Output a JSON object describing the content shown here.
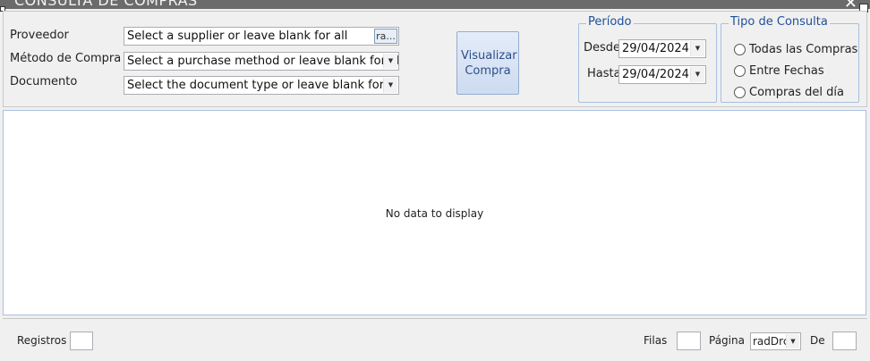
{
  "window": {
    "title": "CONSULTA DE COMPRAS",
    "close_glyph": "✕"
  },
  "filters": {
    "supplier_label": "Proveedor",
    "supplier_placeholder": "Select a supplier or leave blank for all",
    "supplier_button": "ra...",
    "method_label": "Método de Compra",
    "method_placeholder": "Select a purchase method or leave blank for all",
    "document_label": "Documento",
    "document_placeholder": "Select the document type or leave blank for all"
  },
  "view_button": {
    "label": "Visualizar Compra"
  },
  "period": {
    "title": "Período",
    "from_label": "Desde",
    "from_value": "29/04/2024",
    "to_label": "Hasta",
    "to_value": "29/04/2024"
  },
  "query_type": {
    "title": "Tipo de Consulta",
    "options": [
      "Todas las Compras",
      "Entre Fechas",
      "Compras del día"
    ]
  },
  "grid": {
    "empty_text": "No data to display"
  },
  "footer": {
    "records_label": "Registros",
    "rows_label": "Filas",
    "page_label": "Página",
    "page_value": "radDrc",
    "of_label": "De"
  }
}
